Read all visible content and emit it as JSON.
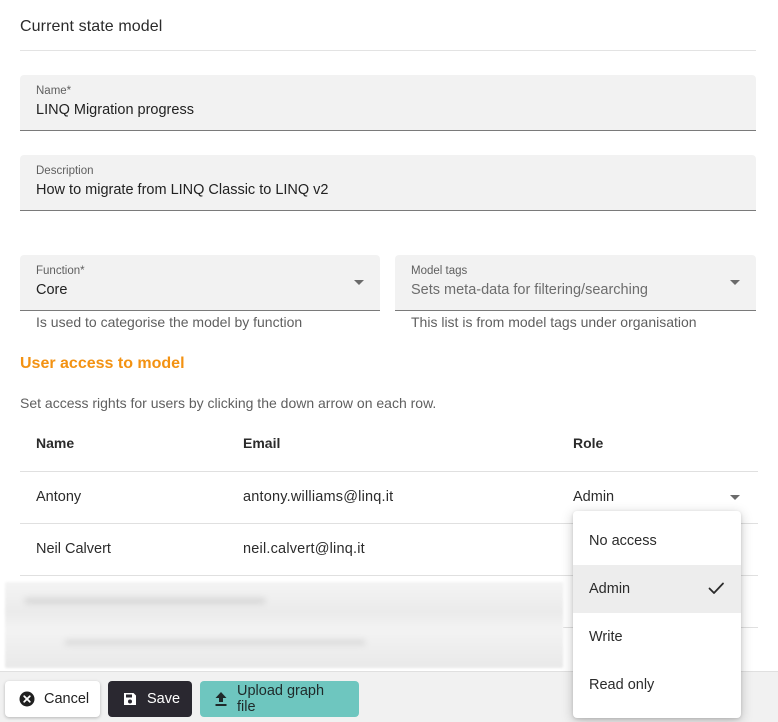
{
  "section_title": "Current state model",
  "fields": {
    "name": {
      "label": "Name*",
      "value": "LINQ Migration progress"
    },
    "description": {
      "label": "Description",
      "value": "How to migrate from LINQ Classic to LINQ v2"
    },
    "function": {
      "label": "Function*",
      "value": "Core",
      "helper": "Is used to categorise the model by function"
    },
    "model_tags": {
      "label": "Model tags",
      "placeholder": "Sets meta-data for filtering/searching",
      "helper": "This list is from model tags under organisation"
    }
  },
  "user_access": {
    "title": "User access to model",
    "description": "Set access rights for users by clicking the down arrow on each row.",
    "columns": [
      "Name",
      "Email",
      "Role"
    ],
    "rows": [
      {
        "name": "Antony",
        "email": "antony.williams@linq.it",
        "role": "Admin"
      },
      {
        "name": "Neil Calvert",
        "email": "neil.calvert@linq.it"
      }
    ]
  },
  "role_menu": {
    "options": [
      "No access",
      "Admin",
      "Write",
      "Read only"
    ],
    "selected": "Admin"
  },
  "buttons": {
    "cancel": "Cancel",
    "save": "Save",
    "upload": "Upload graph file"
  },
  "colors": {
    "accent_orange": "#f39212",
    "save_bg": "#2a2830",
    "upload_bg": "#6ec6bf"
  }
}
